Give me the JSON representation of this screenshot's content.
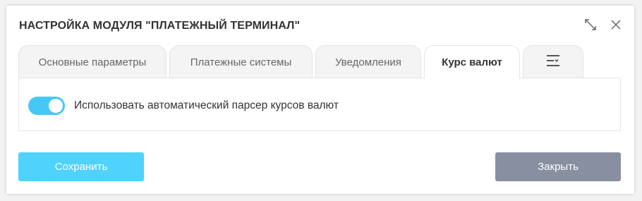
{
  "dialog": {
    "title": "НАСТРОЙКА МОДУЛЯ \"ПЛАТЕЖНЫЙ ТЕРМИНАЛ\"",
    "header_icons": [
      "expand-icon",
      "close-icon"
    ]
  },
  "tabs": [
    {
      "label": "Основные параметры",
      "active": false
    },
    {
      "label": "Платежные системы",
      "active": false
    },
    {
      "label": "Уведомления",
      "active": false
    },
    {
      "label": "Курс валют",
      "active": true
    },
    {
      "label": "",
      "icon": "menu-lines-icon",
      "active": false
    }
  ],
  "panel": {
    "toggle": {
      "on": true,
      "label": "Использовать автоматический парсер курсов валют"
    }
  },
  "buttons": {
    "save_label": "Сохранить",
    "close_label": "Закрыть"
  },
  "colors": {
    "accent": "#45c8f5",
    "save_button": "#4fd2fb",
    "close_button": "#878fa0",
    "tab_inactive": "#f4f4f4"
  }
}
